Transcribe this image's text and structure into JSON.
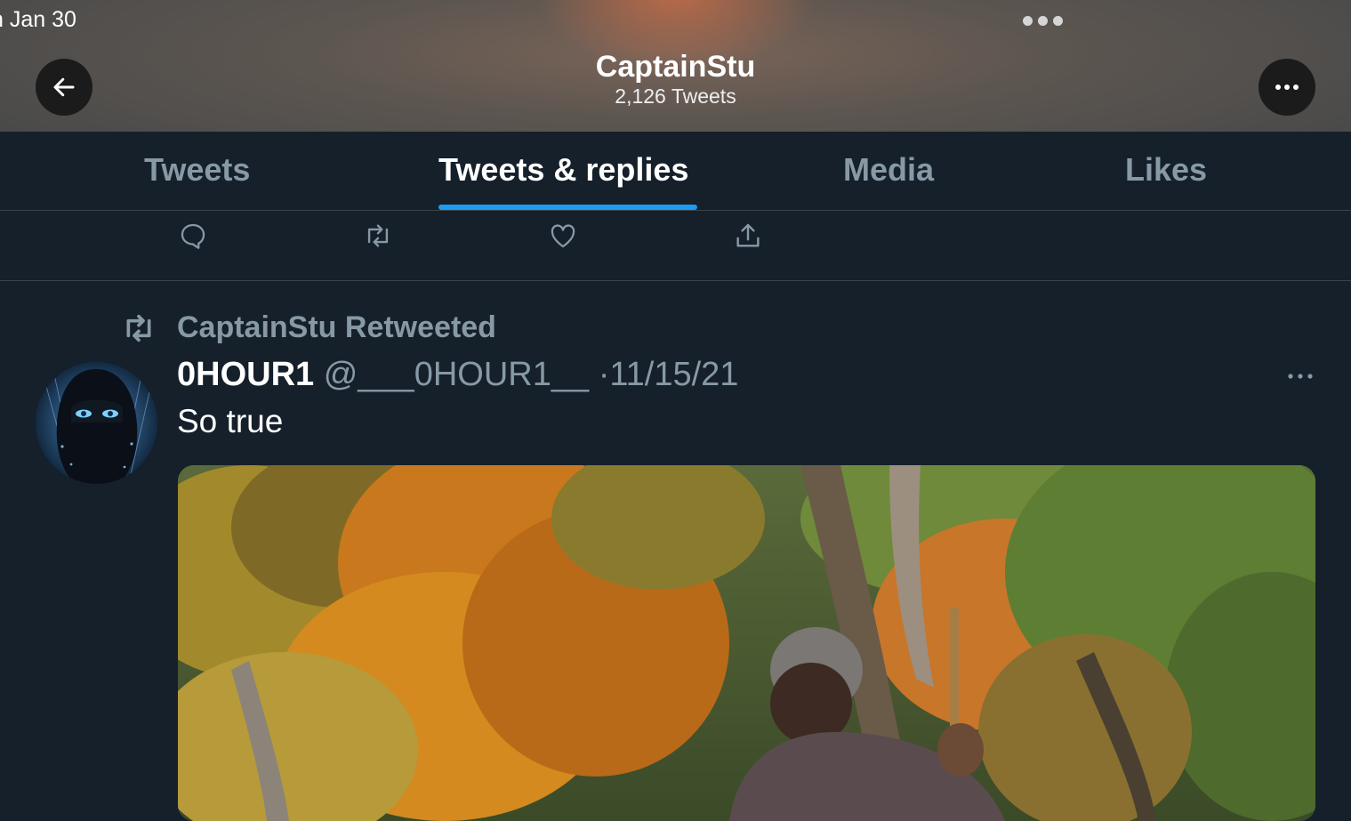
{
  "status_bar": {
    "time_text": "n Jan 30"
  },
  "header": {
    "profile_name": "CaptainStu",
    "tweet_count": "2,126 Tweets"
  },
  "tabs": [
    {
      "label": "Tweets",
      "active": false
    },
    {
      "label": "Tweets & replies",
      "active": true
    },
    {
      "label": "Media",
      "active": false
    },
    {
      "label": "Likes",
      "active": false
    }
  ],
  "tweet": {
    "retweeted_by": "CaptainStu Retweeted",
    "author_name": "0HOUR1",
    "author_handle": "@___0HOUR1__",
    "separator": "·",
    "date": "11/15/21",
    "text": "So true"
  },
  "colors": {
    "background": "#15202b",
    "accent": "#1d9bf0",
    "secondary_text": "#8899a6",
    "divider": "#38444d"
  },
  "icons": [
    "back-arrow-icon",
    "more-icon",
    "reply-icon",
    "retweet-icon",
    "like-icon",
    "share-icon"
  ]
}
